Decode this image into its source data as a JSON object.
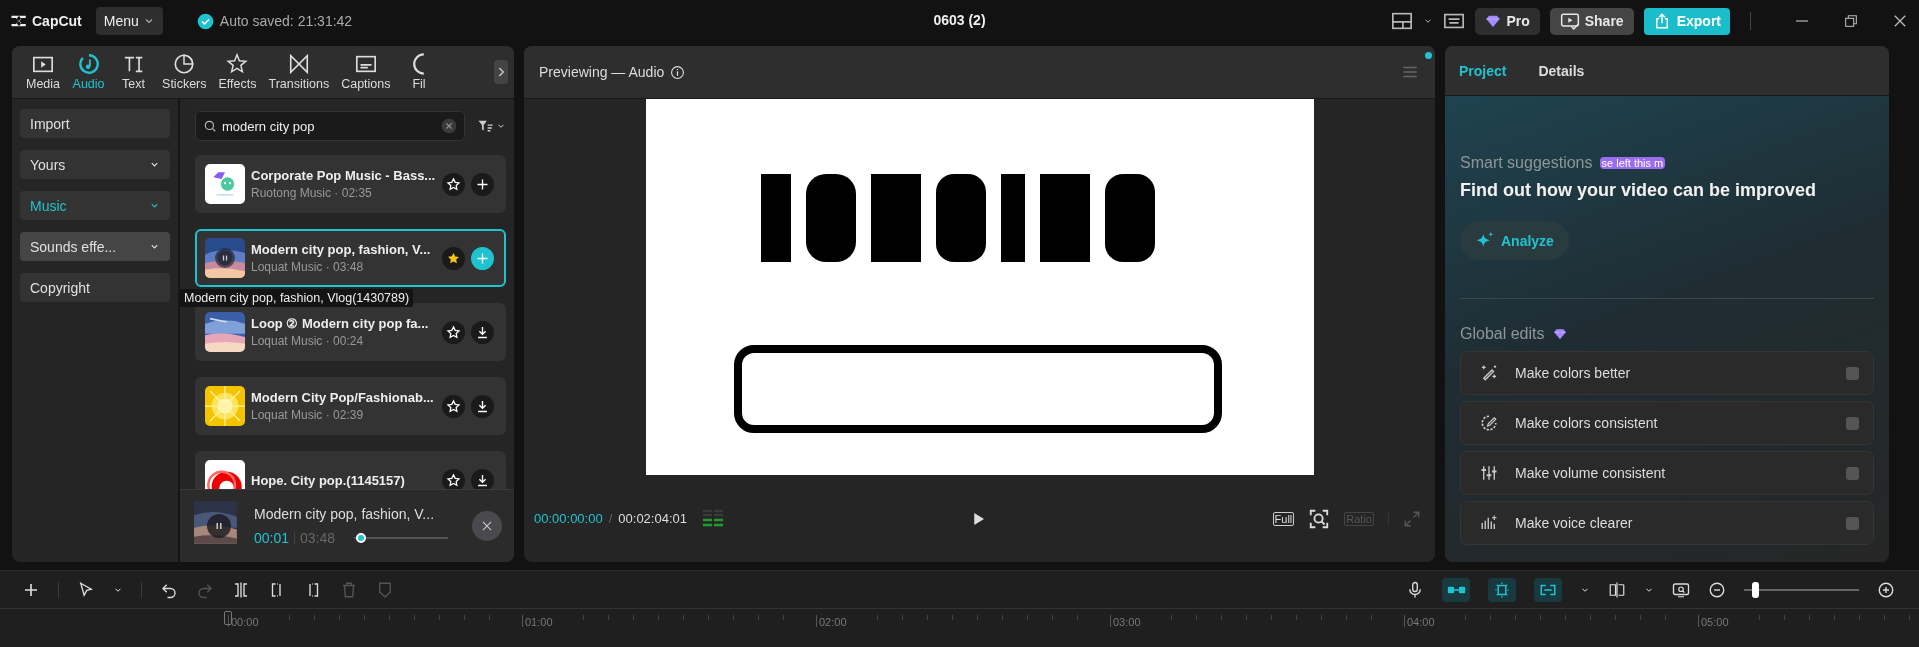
{
  "app": {
    "name": "CapCut"
  },
  "top_bar": {
    "menu": "Menu",
    "autosave": "Auto saved: 21:31:42",
    "project_title": "0603 (2)",
    "pro": "Pro",
    "share": "Share",
    "export": "Export"
  },
  "media_tabs": [
    {
      "label": "Media",
      "selected": false
    },
    {
      "label": "Audio",
      "selected": true
    },
    {
      "label": "Text",
      "selected": false
    },
    {
      "label": "Stickers",
      "selected": false
    },
    {
      "label": "Effects",
      "selected": false
    },
    {
      "label": "Transitions",
      "selected": false
    },
    {
      "label": "Captions",
      "selected": false
    },
    {
      "label": "Fil",
      "selected": false
    }
  ],
  "audio_sidebar": [
    {
      "label": "Import",
      "kind": "plain",
      "selected": false,
      "highlighted": false
    },
    {
      "label": "Yours",
      "kind": "dropdown",
      "selected": false,
      "highlighted": false
    },
    {
      "label": "Music",
      "kind": "dropdown",
      "selected": true,
      "highlighted": false
    },
    {
      "label": "Sounds effe...",
      "kind": "dropdown",
      "selected": false,
      "highlighted": true
    },
    {
      "label": "Copyright",
      "kind": "plain",
      "selected": false,
      "highlighted": false
    }
  ],
  "search": {
    "value": "modern city pop"
  },
  "tracks": [
    {
      "title": "Corporate Pop Music - Bass...",
      "subtitle": "Ruotong Music · 02:35",
      "favorite": false,
      "kind": "add",
      "selected": false,
      "playing": false
    },
    {
      "title": "Modern city pop, fashion, V...",
      "subtitle": "Loquat Music · 03:48",
      "favorite": true,
      "kind": "add",
      "selected": true,
      "playing": true
    },
    {
      "title": "Loop ② Modern city pop fa...",
      "subtitle": "Loquat Music · 00:24",
      "favorite": false,
      "kind": "download",
      "selected": false,
      "playing": false
    },
    {
      "title": "Modern City Pop/Fashionab...",
      "subtitle": "Loquat Music · 02:39",
      "favorite": false,
      "kind": "download",
      "selected": false,
      "playing": false
    },
    {
      "title": "Hope. City pop.(1145157)",
      "favorite": false,
      "kind": "download",
      "selected": false,
      "playing": false
    }
  ],
  "tooltip": "Modern city pop, fashion, Vlog(1430789)",
  "player": {
    "title": "Modern city pop, fashion, V...",
    "elapsed": "00:01",
    "duration": "03:48",
    "level": 0.02,
    "playing": true
  },
  "preview": {
    "title": "Previewing — Audio",
    "current_time": "00:00:00:00",
    "separator": "/",
    "total_time": "00:02:04:01",
    "full": "Full",
    "ratio": {
      "label": "Ratio",
      "disabled": true
    }
  },
  "right_panel": {
    "tabs": [
      {
        "label": "Project",
        "selected": true
      },
      {
        "label": "Details",
        "selected": false
      }
    ],
    "section_label": "Smart suggestions",
    "badge": "se left this m",
    "heading": "Find out how your video can be improved",
    "analyze": "Analyze",
    "global_edits": "Global edits",
    "edits": [
      {
        "label": "Make colors better",
        "on": false
      },
      {
        "label": "Make colors consistent",
        "on": false
      },
      {
        "label": "Make volume consistent",
        "on": false
      },
      {
        "label": "Make voice clearer",
        "on": false
      }
    ]
  },
  "timeline": {
    "tools": [
      {
        "disabled": false
      },
      {
        "disabled": false
      },
      {
        "disabled": false
      },
      {
        "disabled": true
      },
      {
        "disabled": false
      },
      {
        "disabled": false
      },
      {
        "disabled": false
      },
      {
        "disabled": true
      },
      {
        "disabled": true
      }
    ],
    "toggles": [
      {
        "on": true
      },
      {
        "on": true
      },
      {
        "on": true
      }
    ],
    "zoom": {
      "level": 0.07
    },
    "ruler": [
      "00:00",
      "01:00",
      "02:00",
      "03:00",
      "04:00",
      "05:00"
    ]
  }
}
